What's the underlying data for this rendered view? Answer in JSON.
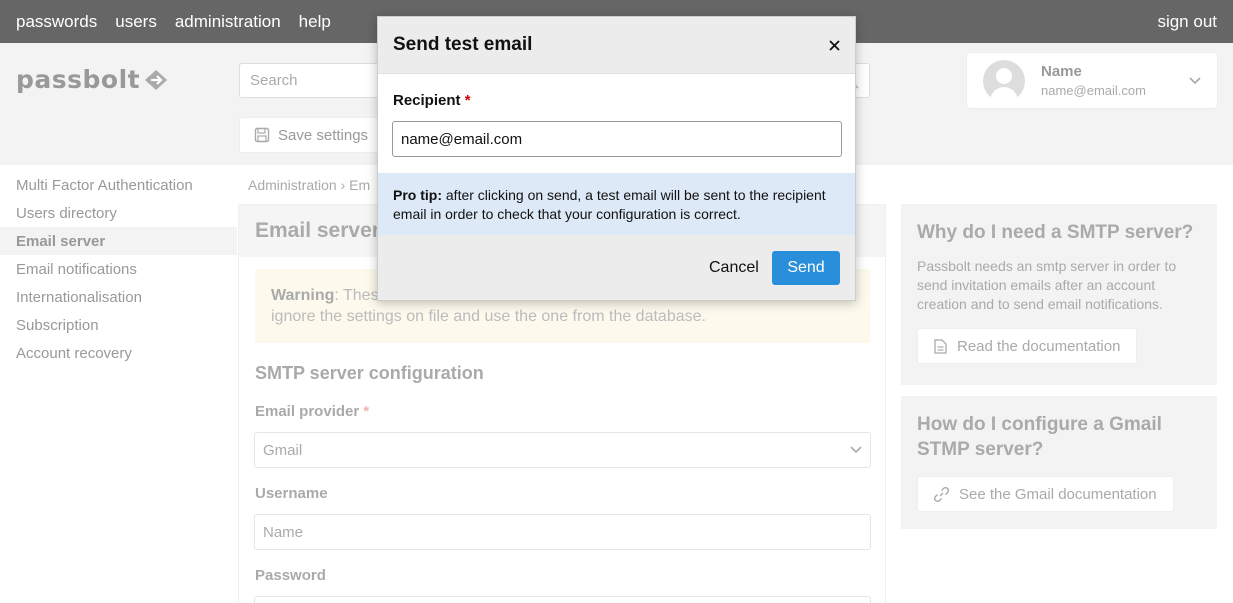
{
  "topnav": {
    "items": [
      "passwords",
      "users",
      "administration",
      "help"
    ],
    "signout": "sign out"
  },
  "logo": {
    "text": "passbolt"
  },
  "search": {
    "placeholder": "Search"
  },
  "profile": {
    "name": "Name",
    "email": "name@email.com"
  },
  "toolbar": {
    "save_label": "Save settings"
  },
  "sidebar": {
    "items": [
      {
        "label": "Multi Factor Authentication"
      },
      {
        "label": "Users directory"
      },
      {
        "label": "Email server"
      },
      {
        "label": "Email notifications"
      },
      {
        "label": "Internationalisation"
      },
      {
        "label": "Subscription"
      },
      {
        "label": "Account recovery"
      }
    ]
  },
  "breadcrumb": {
    "text": "Administration › Em"
  },
  "main": {
    "title": "Email server",
    "warning_bold": "Warning",
    "warning_text": ": Thes",
    "warning_line2": "ignore the settings on file and use the one from the database.",
    "section_title": "SMTP server configuration",
    "provider_label": "Email provider",
    "provider_value": "Gmail",
    "username_label": "Username",
    "username_placeholder": "Name",
    "password_label": "Password",
    "required_mark": "*"
  },
  "help": {
    "smtp_title": "Why do I need a SMTP server?",
    "smtp_text": "Passbolt needs an smtp server in order to send invitation emails after an account creation and to send email notifications.",
    "smtp_button": "Read the documentation",
    "gmail_title": "How do I configure a Gmail STMP server?",
    "gmail_button": "See the Gmail documentation"
  },
  "dialog": {
    "title": "Send test email",
    "recipient_label": "Recipient",
    "required_mark": "*",
    "recipient_value": "name@email.com",
    "protip_bold": "Pro tip:",
    "protip_text": " after clicking on send, a test email will be sent to the recipient email in order to check that your configuration is correct.",
    "cancel_label": "Cancel",
    "send_label": "Send"
  },
  "colors": {
    "topnav": "#666666",
    "send_button": "#2a8fdb",
    "protip_bg": "#dde9f7",
    "required": "#d40101"
  }
}
